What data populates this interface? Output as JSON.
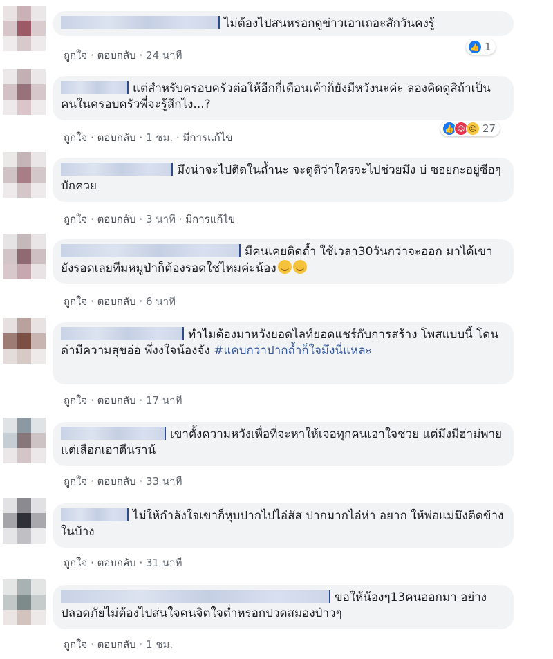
{
  "colors": {
    "bubble": "#f2f3f5",
    "link": "#385898",
    "meta": "#606770",
    "like_blue": "#1877f2"
  },
  "actions": {
    "like": "ถูกใจ",
    "reply": "ตอบกลับ",
    "separator": "·",
    "edited": "มีการแก้ไข"
  },
  "comments": [
    {
      "text": "ไม่ต้องไปสนหรอกดูข่าวเอาเถอะสักวันคงรู้",
      "time": "24 นาที",
      "reaction_count": "1"
    },
    {
      "text": "แต่สำหรับครอบครัวต่อให้อีกกี่เดือนเค้าก็ยังมีหวังนะค่ะ ลองคิดดูสิถ้าเป็นคนในครอบครัวพี่จะรู้สึกไง...?",
      "time": "1 ชม.",
      "reaction_count": "27"
    },
    {
      "text": "มึงน่าจะไปติดในถ้ำนะ จะดูดิว่าใครจะไปช่วยมึง บ่ ซอยกะอยู่ซือๆ บักควย",
      "time": "3 นาที"
    },
    {
      "text": "มีคนเคยติดถ้ำ ใช้เวลา30วันกว่าจะออก มาได้เขายังรอดเลยทีมหมูป่าก็ต้องรอดใช่ไหมค่ะน้อง",
      "time": "6 นาที"
    },
    {
      "text": "ทำไมต้องมาหวังยอดไลท์ยอดแชร์กับการสร้าง โพสแบบนี้ โดนด่ามีความสุขอ่อ พึ่งงใจน้องจัง",
      "hashtag": "#แคบกว่าปากถ้ำก็ใจมึงนี่แหละ",
      "time": "17 นาที"
    },
    {
      "text": "เขาตั้งความหวังเพื่อที่จะหาให้เจอทุกคนเอาใจช่วย แต่มึงมีฮ่าม่พายแต่เสือกเอาตีนราน้",
      "time": "33 นาที"
    },
    {
      "text": "ไม่ให้กำลังใจเขาก็หุบปากไปไอ่สัส ปากมากไอ่ห่า อยาก ให้พ่อแม่มึงติดข้างในบ้าง",
      "time": "31 นาที"
    },
    {
      "text": "ขอให้น้องๆ13คนออกมา อย่างปลอดภัยไม่ต้องไปส่นใจคนจิตใจต่ำหรอกปวดสมองป่าวๆ",
      "time": "1 ชม."
    }
  ]
}
